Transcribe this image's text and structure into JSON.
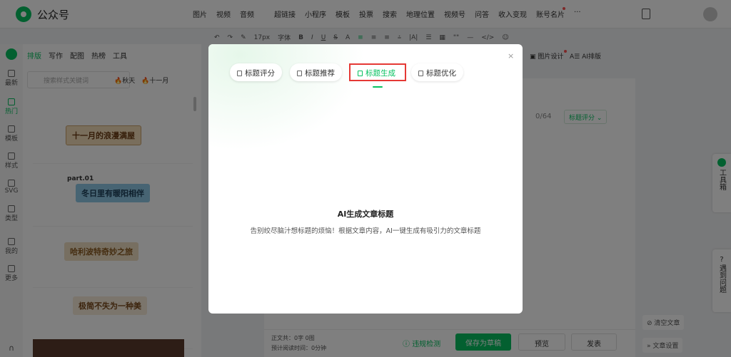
{
  "app": {
    "brand": "公众号"
  },
  "topnav": [
    "图片",
    "视频",
    "音频",
    "超链接",
    "小程序",
    "模板",
    "投票",
    "搜索",
    "地理位置",
    "视频号",
    "问答",
    "收入变现",
    "账号名片",
    "···"
  ],
  "toolbar": [
    "17px",
    "字体",
    "B",
    "I",
    "U",
    "S",
    "A",
    "≡",
    "≡",
    "≡",
    "⩮",
    "|A|",
    "☰",
    "▦",
    "\"\"",
    "—",
    "</>",
    "☺"
  ],
  "toolbar_extra": {
    "image_design": "图片设计",
    "ai_layout": "AI排版"
  },
  "rail": [
    {
      "label": "最新"
    },
    {
      "label": "热门"
    },
    {
      "label": "模板"
    },
    {
      "label": "样式"
    },
    {
      "label": "SVG"
    },
    {
      "label": "类型"
    },
    {
      "label": "我的"
    },
    {
      "label": "更多"
    }
  ],
  "panel": {
    "tabs": [
      "排版",
      "写作",
      "配图",
      "热榜",
      "工具"
    ],
    "search_placeholder": "搜索样式关键词",
    "tags": [
      "秋天",
      "十一月"
    ],
    "cards": [
      {
        "text": "十一月的浪漫满屋"
      },
      {
        "sub": "part.01",
        "text": "冬日里有暖阳相伴"
      },
      {
        "text": "哈利波特奇妙之旅"
      },
      {
        "text": "极简不失为一种美"
      }
    ]
  },
  "editor": {
    "count": "0/64",
    "title_score_btn": "标题评分",
    "stats_words": "正文共：0字 0图",
    "stats_time": "预计阅读时间：0分钟",
    "check_btn": "违规检测",
    "save_btn": "保存为草稿",
    "preview_btn": "预览",
    "publish_btn": "发表"
  },
  "right": {
    "toolbox": "工具箱",
    "help": "遇到问题",
    "clear": "清空文章",
    "settings": "文章设置"
  },
  "modal": {
    "close": "×",
    "tabs": [
      {
        "label": "标题评分"
      },
      {
        "label": "标题推荐"
      },
      {
        "label": "标题生成"
      },
      {
        "label": "标题优化"
      }
    ],
    "active_tab": "标题生成",
    "title": "AI生成文章标题",
    "desc": "告别绞尽脑汁想标题的烦恼！根据文章内容，AI一键生成有吸引力的文章标题"
  },
  "colors": {
    "accent": "#07c160",
    "highlight": "#e53935"
  }
}
